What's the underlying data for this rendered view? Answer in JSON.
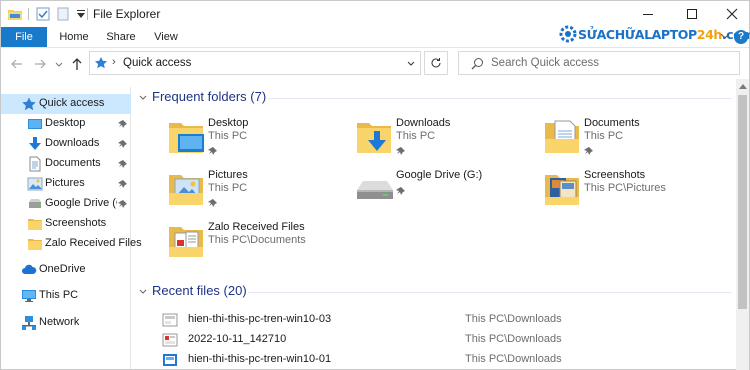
{
  "window": {
    "title": "File Explorer"
  },
  "brand": {
    "main": "SỬACHỮALAPTOP",
    "accent": "24h",
    "suffix": ".com"
  },
  "ribbon": {
    "tabs": [
      "File",
      "Home",
      "Share",
      "View"
    ]
  },
  "address": {
    "location": "Quick access",
    "search_placeholder": "Search Quick access"
  },
  "nav": {
    "items": [
      {
        "label": "Quick access",
        "icon": "star-icon",
        "pinned": false
      },
      {
        "label": "Desktop",
        "icon": "desktop-icon",
        "pinned": true
      },
      {
        "label": "Downloads",
        "icon": "downloads-icon",
        "pinned": true
      },
      {
        "label": "Documents",
        "icon": "documents-icon",
        "pinned": true
      },
      {
        "label": "Pictures",
        "icon": "pictures-icon",
        "pinned": true
      },
      {
        "label": "Google Drive (G:",
        "icon": "drive-icon",
        "pinned": true
      },
      {
        "label": "Screenshots",
        "icon": "folder-icon",
        "pinned": false
      },
      {
        "label": "Zalo Received Files",
        "icon": "folder-icon",
        "pinned": false
      },
      {
        "label": "OneDrive",
        "icon": "onedrive-icon",
        "pinned": false
      },
      {
        "label": "This PC",
        "icon": "computer-icon",
        "pinned": false
      },
      {
        "label": "Network",
        "icon": "network-icon",
        "pinned": false
      }
    ]
  },
  "frequent": {
    "title": "Frequent folders (7)",
    "items": [
      {
        "name": "Desktop",
        "path": "This PC",
        "pinned": true,
        "icon": "desktop-folder-icon"
      },
      {
        "name": "Downloads",
        "path": "This PC",
        "pinned": true,
        "icon": "downloads-folder-icon"
      },
      {
        "name": "Documents",
        "path": "This PC",
        "pinned": true,
        "icon": "documents-folder-icon"
      },
      {
        "name": "Pictures",
        "path": "This PC",
        "pinned": true,
        "icon": "pictures-folder-icon"
      },
      {
        "name": "Google Drive (G:)",
        "path": "",
        "pinned": true,
        "icon": "drive-icon"
      },
      {
        "name": "Screenshots",
        "path": "This PC\\Pictures",
        "pinned": false,
        "icon": "screenshots-folder-icon"
      },
      {
        "name": "Zalo Received Files",
        "path": "This PC\\Documents",
        "pinned": false,
        "icon": "zalo-folder-icon"
      }
    ]
  },
  "recent": {
    "title": "Recent files (20)",
    "items": [
      {
        "name": "hien-thi-this-pc-tren-win10-03",
        "path": "This PC\\Downloads",
        "icon": "image-file-icon"
      },
      {
        "name": "2022-10-11_142710",
        "path": "This PC\\Downloads",
        "icon": "image-file-icon"
      },
      {
        "name": "hien-thi-this-pc-tren-win10-01",
        "path": "This PC\\Downloads",
        "icon": "image-file-icon"
      }
    ]
  },
  "colors": {
    "accent": "#1979ca",
    "selection": "#cce8ff",
    "group_title": "#1e3287",
    "brand_blue": "#1b73c8",
    "brand_orange": "#f2a20d"
  }
}
